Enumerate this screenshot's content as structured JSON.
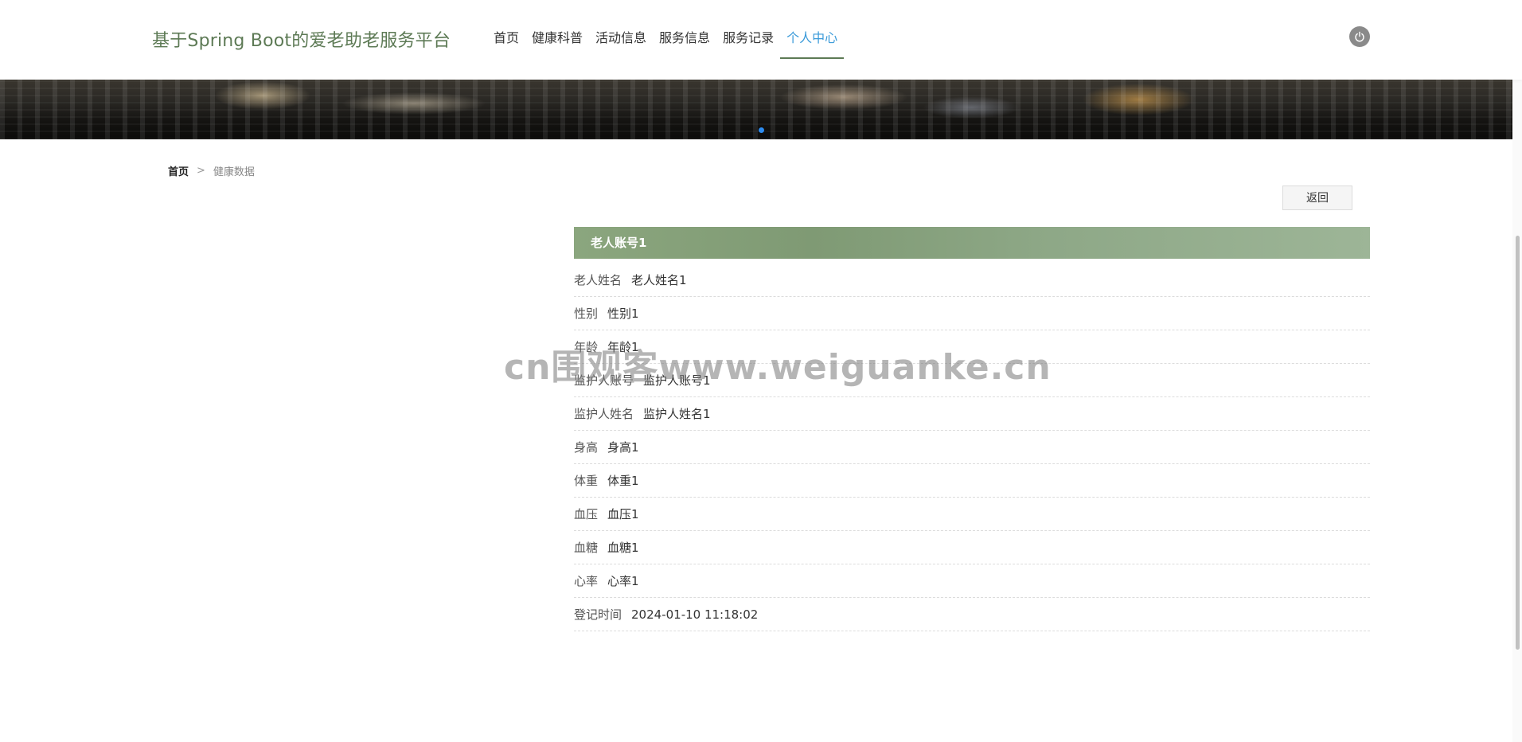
{
  "header": {
    "brand": "基于Spring Boot的爱老助老服务平台",
    "nav": [
      {
        "label": "首页"
      },
      {
        "label": "健康科普"
      },
      {
        "label": "活动信息"
      },
      {
        "label": "服务信息"
      },
      {
        "label": "服务记录"
      },
      {
        "label": "个人中心",
        "active": true
      }
    ],
    "logout_icon": "power-icon"
  },
  "banner": {
    "slides": 1,
    "active_slide": 1
  },
  "breadcrumb": {
    "home": "首页",
    "separator": ">",
    "current": "健康数据"
  },
  "back_label": "返回",
  "detail": {
    "title": "老人账号1",
    "rows": [
      {
        "label": "老人姓名",
        "value": "老人姓名1"
      },
      {
        "label": "性别",
        "value": "性别1"
      },
      {
        "label": "年龄",
        "value": "年龄1"
      },
      {
        "label": "监护人账号",
        "value": "监护人账号1"
      },
      {
        "label": "监护人姓名",
        "value": "监护人姓名1"
      },
      {
        "label": "身高",
        "value": "身高1"
      },
      {
        "label": "体重",
        "value": "体重1"
      },
      {
        "label": "血压",
        "value": "血压1"
      },
      {
        "label": "血糖",
        "value": "血糖1"
      },
      {
        "label": "心率",
        "value": "心率1"
      },
      {
        "label": "登记时间",
        "value": "2024-01-10 11:18:02"
      }
    ]
  },
  "watermark": "cn围观客www.weiguanke.cn",
  "colors": {
    "brand": "#5d7a55",
    "nav_active": "#3a9ad9",
    "title_bar": "#8ba67e",
    "banner_dot": "#2d8cf0"
  }
}
